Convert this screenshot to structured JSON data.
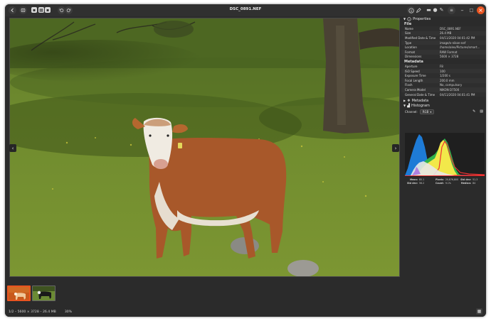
{
  "window": {
    "title": "DSC_0891.NEF"
  },
  "toolbar": {
    "back_icon": "chevron-left-icon",
    "nav_icon": "gallery-icon",
    "rotate_left_icon": "rotate-left-icon",
    "rotate_right_icon": "rotate-right-icon",
    "info_icon": "info-icon",
    "edit_icon": "pencil-icon",
    "close_label": "×",
    "minimize_label": "–",
    "maximize_label": "□"
  },
  "sidebar": {
    "properties_title": "Properties",
    "file_group": "File",
    "file_rows": [
      {
        "k": "Name",
        "v": "DSC_0891.NEF"
      },
      {
        "k": "Size",
        "v": "26.4 MB"
      },
      {
        "k": "Modified Date & Time",
        "v": "04/11/2020 04:01:42 PM"
      },
      {
        "k": "Type",
        "v": "image/x-nikon-nef"
      },
      {
        "k": "Location",
        "v": "/home/alex/Pictures/smart..."
      },
      {
        "k": "Format",
        "v": "RAW Format"
      },
      {
        "k": "Dimensions",
        "v": "5600 × 3728"
      }
    ],
    "metadata_group": "Metadata",
    "meta_rows": [
      {
        "k": "Aperture",
        "v": "F8"
      },
      {
        "k": "ISO Speed",
        "v": "100"
      },
      {
        "k": "Exposure Time",
        "v": "1/200 s"
      },
      {
        "k": "Focal Length",
        "v": "200.0 mm"
      },
      {
        "k": "Flash",
        "v": "No, compulsory"
      },
      {
        "k": "Camera Model",
        "v": "NIKON D7500"
      },
      {
        "k": "General Date & Time",
        "v": "04/11/2020 04:01:41 PM"
      }
    ],
    "metadata_section": "Metadata",
    "histogram_section": "Histogram",
    "channel_label": "Channel:",
    "channel_value": "RGB",
    "stats": [
      {
        "k": "Mean:",
        "v": "85.1"
      },
      {
        "k": "Pixels:",
        "v": "20,876,800"
      },
      {
        "k": "Std dev:",
        "v": "51.3"
      },
      {
        "k": "Std dev:",
        "v": "56.2"
      },
      {
        "k": "Count:",
        "v": "9.1%"
      },
      {
        "k": "Median:",
        "v": "84"
      }
    ]
  },
  "status": {
    "position": "1/2",
    "dimensions": "5600 × 3728",
    "size": "26.4 MB",
    "zoom": "30%"
  },
  "colors": {
    "accent": "#e95420",
    "bg": "#2b2b2b"
  }
}
